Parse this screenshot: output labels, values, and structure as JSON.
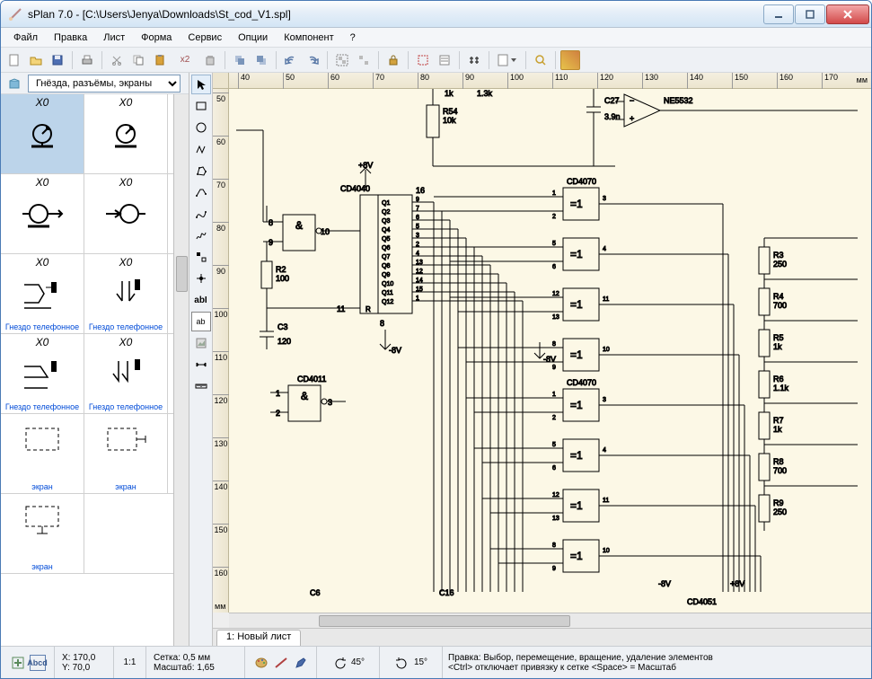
{
  "window": {
    "title": "sPlan 7.0 - [C:\\Users\\Jenya\\Downloads\\St_cod_V1.spl]"
  },
  "menu": {
    "file": "Файл",
    "edit": "Правка",
    "sheet": "Лист",
    "form": "Форма",
    "service": "Сервис",
    "options": "Опции",
    "component": "Компонент",
    "help": "?"
  },
  "library": {
    "selected": "Гнёзда, разъёмы, экраны"
  },
  "components": {
    "r0c0": {
      "label": "X0"
    },
    "r0c1": {
      "label": "X0"
    },
    "r1c0": {
      "label": "X0"
    },
    "r1c1": {
      "label": "X0"
    },
    "r2c0": {
      "label": "X0",
      "name": "Гнездо телефонное"
    },
    "r2c1": {
      "label": "X0",
      "name": "Гнездо телефонное"
    },
    "r3c0": {
      "label": "X0",
      "name": "Гнездо телефонное"
    },
    "r3c1": {
      "label": "X0",
      "name": "Гнездо телефонное"
    },
    "r4c0": {
      "label": "",
      "name": "экран"
    },
    "r4c1": {
      "label": "",
      "name": "экран"
    },
    "r5c0": {
      "label": "",
      "name": "экран"
    }
  },
  "rulers": {
    "h": [
      "40",
      "50",
      "60",
      "70",
      "80",
      "90",
      "100",
      "110",
      "120",
      "130",
      "140",
      "150",
      "160",
      "170"
    ],
    "h_unit": "мм",
    "v": [
      "50",
      "60",
      "70",
      "80",
      "90",
      "100",
      "110",
      "120",
      "130",
      "140",
      "150",
      "160"
    ],
    "v_unit": "мм"
  },
  "schematic": {
    "r54": "R54",
    "r54v": "10k",
    "v1k": "1k",
    "v13k": "1.3k",
    "c27": "C27",
    "c27v": "3.9n",
    "ne5532": "NE5532",
    "p8v": "+8V",
    "m8v": "-8V",
    "cd4040": "CD4040",
    "cd4070": "CD4070",
    "cd4011": "CD4011",
    "r2": "R2",
    "r2v": "100",
    "c3": "C3",
    "c3v": "120",
    "and": "&",
    "xor": "=1",
    "ic_pins_top": "16",
    "cd4051": "CD4051",
    "c6": "C6",
    "c16": "C16",
    "r3": "R3",
    "r3v": "250",
    "r4": "R4",
    "r4v": "700",
    "r5": "R5",
    "r5v": "1k",
    "r6": "R6",
    "r6v": "1.1k",
    "r7": "R7",
    "r7v": "1k",
    "r8": "R8",
    "r8v": "700",
    "r9": "R9",
    "r9v": "250"
  },
  "tabs": {
    "sheet1": "1: Новый лист"
  },
  "status": {
    "x_label": "X: 170,0",
    "y_label": "Y: 70,0",
    "ratio": "1:1",
    "grid": "Сетка: 0,5 мм",
    "scale": "Масштаб:  1,65",
    "angle1": "45°",
    "angle2": "15°",
    "hint1": "Правка: Выбор, перемещение, вращение, удаление элементов",
    "hint2": "<Ctrl> отключает привязку к сетке <Space> = Масштаб"
  },
  "toolbar_x2": "x2"
}
